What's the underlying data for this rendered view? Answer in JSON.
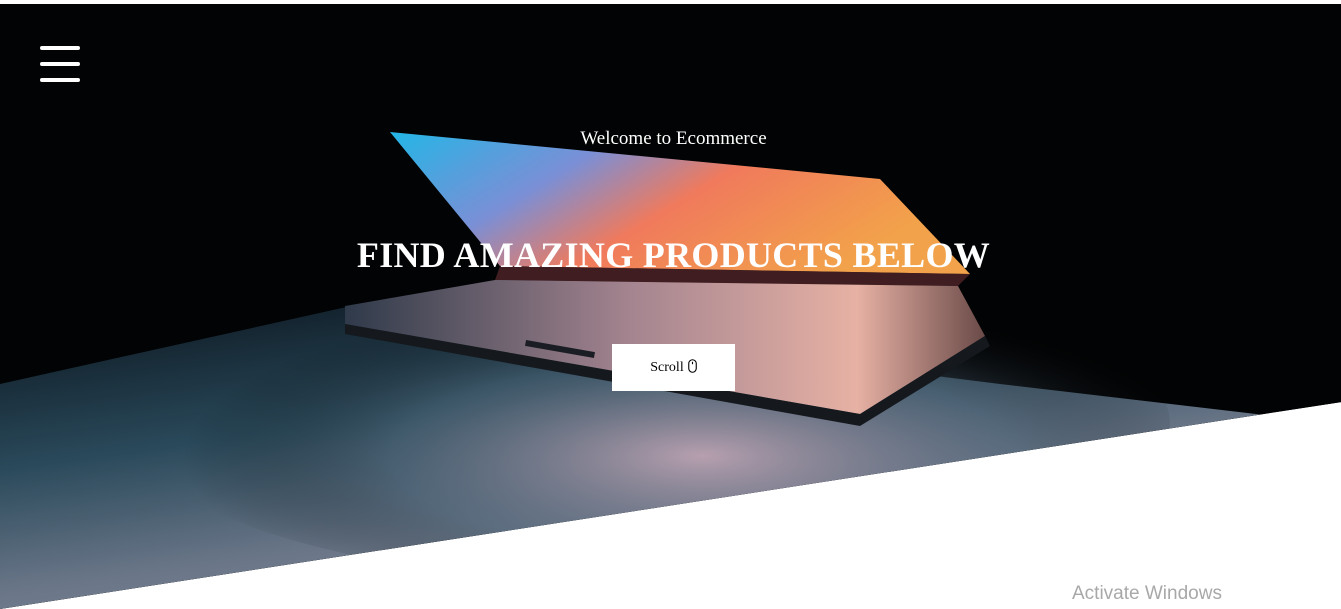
{
  "header": {
    "menu_icon": "hamburger-menu-icon"
  },
  "hero": {
    "welcome_text": "Welcome to Ecommerce",
    "headline": "FIND AMAZING PRODUCTS BELOW",
    "scroll_label": "Scroll",
    "scroll_icon": "mouse-icon",
    "background_color": "#000000"
  },
  "watermark": {
    "text": "Activate Windows"
  }
}
